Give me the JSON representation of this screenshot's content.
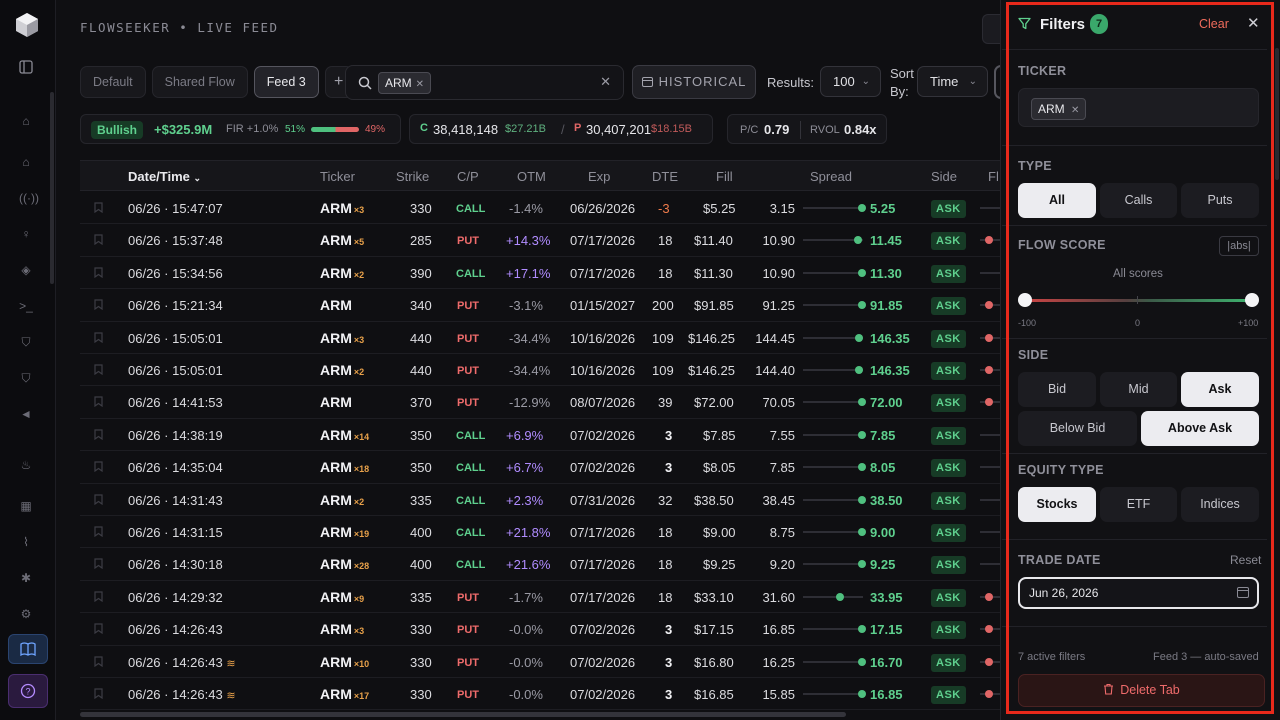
{
  "app": {
    "brand": "FLOWSEEKER • LIVE FEED"
  },
  "rail": {
    "icons": [
      "sidebar-toggle-icon",
      "home-icon",
      "home-alt-icon",
      "broadcast-icon",
      "lightbulb-icon",
      "graduation-cap-icon",
      "terminal-icon",
      "shield-icon",
      "shield-alt-icon",
      "megaphone-icon",
      "flame-icon",
      "grid-icon",
      "chart-icon",
      "bug-icon",
      "settings-icon"
    ],
    "book_icon": "book-icon",
    "help_icon": "help-icon"
  },
  "tabs": [
    {
      "label": "Default",
      "active": false
    },
    {
      "label": "Shared Flow",
      "active": false
    },
    {
      "label": "Feed 3",
      "active": true
    }
  ],
  "search": {
    "chip": "ARM",
    "clear": "✕"
  },
  "toolbar": {
    "historical": "HISTORICAL",
    "results_label": "Results:",
    "results_value": "100",
    "sort_label_1": "Sort",
    "sort_label_2": "By:",
    "sort_value": "Time"
  },
  "stats": {
    "sentiment": "Bullish",
    "premium": "+$325.9M",
    "fir": "FIR +1.0%",
    "bull_pct": "51%",
    "bear_pct": "49%",
    "bull_fraction": 0.51,
    "calls_prefix": "C",
    "calls_count": "38,418,148",
    "calls_premium": "$27.21B",
    "sep": "/",
    "puts_prefix": "P",
    "puts_count": "30,407,201",
    "puts_premium": "$18.15B",
    "pc_label": "P/C",
    "pc_value": "0.79",
    "rvol_label": "RVOL",
    "rvol_value": "0.84x"
  },
  "table": {
    "headers": {
      "datetime": "Date/Time",
      "ticker": "Ticker",
      "strike": "Strike",
      "cp": "C/P",
      "otm": "OTM",
      "exp": "Exp",
      "dte": "DTE",
      "fill": "Fill",
      "spread": "Spread",
      "side": "Side",
      "fl": "Fl"
    },
    "rows": [
      {
        "dt": "06/26 · 15:47:07",
        "ticker": "ARM",
        "mult": "×3",
        "strike": "330",
        "cp": "CALL",
        "otm": "-1.4%",
        "exp": "06/26/2026",
        "dte": "-3",
        "fill": "$5.25",
        "bid": "3.15",
        "ask_px": "5.25",
        "side": "ASK",
        "pos": 0.98
      },
      {
        "dt": "06/26 · 15:37:48",
        "ticker": "ARM",
        "mult": "×5",
        "strike": "285",
        "cp": "PUT",
        "otm": "+14.3%",
        "exp": "07/17/2026",
        "dte": "18",
        "fill": "$11.40",
        "bid": "10.90",
        "ask_px": "11.45",
        "side": "ASK",
        "pos": 0.91
      },
      {
        "dt": "06/26 · 15:34:56",
        "ticker": "ARM",
        "mult": "×2",
        "strike": "390",
        "cp": "CALL",
        "otm": "+17.1%",
        "exp": "07/17/2026",
        "dte": "18",
        "fill": "$11.30",
        "bid": "10.90",
        "ask_px": "11.30",
        "side": "ASK",
        "pos": 0.98
      },
      {
        "dt": "06/26 · 15:21:34",
        "ticker": "ARM",
        "mult": "",
        "strike": "340",
        "cp": "PUT",
        "otm": "-3.1%",
        "exp": "01/15/2027",
        "dte": "200",
        "fill": "$91.85",
        "bid": "91.25",
        "ask_px": "91.85",
        "side": "ASK",
        "pos": 0.98
      },
      {
        "dt": "06/26 · 15:05:01",
        "ticker": "ARM",
        "mult": "×3",
        "strike": "440",
        "cp": "PUT",
        "otm": "-34.4%",
        "exp": "10/16/2026",
        "dte": "109",
        "fill": "$146.25",
        "bid": "144.45",
        "ask_px": "146.35",
        "side": "ASK",
        "pos": 0.93
      },
      {
        "dt": "06/26 · 15:05:01",
        "ticker": "ARM",
        "mult": "×2",
        "strike": "440",
        "cp": "PUT",
        "otm": "-34.4%",
        "exp": "10/16/2026",
        "dte": "109",
        "fill": "$146.25",
        "bid": "144.40",
        "ask_px": "146.35",
        "side": "ASK",
        "pos": 0.93
      },
      {
        "dt": "06/26 · 14:41:53",
        "ticker": "ARM",
        "mult": "",
        "strike": "370",
        "cp": "PUT",
        "otm": "-12.9%",
        "exp": "08/07/2026",
        "dte": "39",
        "fill": "$72.00",
        "bid": "70.05",
        "ask_px": "72.00",
        "side": "ASK",
        "pos": 0.98
      },
      {
        "dt": "06/26 · 14:38:19",
        "ticker": "ARM",
        "mult": "×14",
        "strike": "350",
        "cp": "CALL",
        "otm": "+6.9%",
        "exp": "07/02/2026",
        "dte": "3",
        "fill": "$7.85",
        "bid": "7.55",
        "ask_px": "7.85",
        "side": "ASK",
        "pos": 0.98
      },
      {
        "dt": "06/26 · 14:35:04",
        "ticker": "ARM",
        "mult": "×18",
        "strike": "350",
        "cp": "CALL",
        "otm": "+6.7%",
        "exp": "07/02/2026",
        "dte": "3",
        "fill": "$8.05",
        "bid": "7.85",
        "ask_px": "8.05",
        "side": "ASK",
        "pos": 0.98
      },
      {
        "dt": "06/26 · 14:31:43",
        "ticker": "ARM",
        "mult": "×2",
        "strike": "335",
        "cp": "CALL",
        "otm": "+2.3%",
        "exp": "07/31/2026",
        "dte": "32",
        "fill": "$38.50",
        "bid": "38.45",
        "ask_px": "38.50",
        "side": "ASK",
        "pos": 0.98
      },
      {
        "dt": "06/26 · 14:31:15",
        "ticker": "ARM",
        "mult": "×19",
        "strike": "400",
        "cp": "CALL",
        "otm": "+21.8%",
        "exp": "07/17/2026",
        "dte": "18",
        "fill": "$9.00",
        "bid": "8.75",
        "ask_px": "9.00",
        "side": "ASK",
        "pos": 0.98
      },
      {
        "dt": "06/26 · 14:30:18",
        "ticker": "ARM",
        "mult": "×28",
        "strike": "400",
        "cp": "CALL",
        "otm": "+21.6%",
        "exp": "07/17/2026",
        "dte": "18",
        "fill": "$9.25",
        "bid": "9.20",
        "ask_px": "9.25",
        "side": "ASK",
        "pos": 0.98
      },
      {
        "dt": "06/26 · 14:29:32",
        "ticker": "ARM",
        "mult": "×9",
        "strike": "335",
        "cp": "PUT",
        "otm": "-1.7%",
        "exp": "07/17/2026",
        "dte": "18",
        "fill": "$33.10",
        "bid": "31.60",
        "ask_px": "33.95",
        "side": "ASK",
        "pos": 0.62
      },
      {
        "dt": "06/26 · 14:26:43",
        "ticker": "ARM",
        "mult": "×3",
        "strike": "330",
        "cp": "PUT",
        "otm": "-0.0%",
        "exp": "07/02/2026",
        "dte": "3",
        "fill": "$17.15",
        "bid": "16.85",
        "ask_px": "17.15",
        "side": "ASK",
        "pos": 0.98
      },
      {
        "dt": "06/26 · 14:26:43",
        "ticker": "ARM",
        "mult": "×10",
        "strike": "330",
        "cp": "PUT",
        "otm": "-0.0%",
        "exp": "07/02/2026",
        "dte": "3",
        "fill": "$16.80",
        "bid": "16.25",
        "ask_px": "16.70",
        "side": "ASK",
        "pos": 0.98,
        "sweep": true
      },
      {
        "dt": "06/26 · 14:26:43",
        "ticker": "ARM",
        "mult": "×17",
        "strike": "330",
        "cp": "PUT",
        "otm": "-0.0%",
        "exp": "07/02/2026",
        "dte": "3",
        "fill": "$16.85",
        "bid": "15.85",
        "ask_px": "16.85",
        "side": "ASK",
        "pos": 0.98,
        "sweep": true
      }
    ]
  },
  "filters": {
    "title": "Filters",
    "count": "7",
    "clear": "Clear",
    "ticker_label": "TICKER",
    "ticker_chip": "ARM",
    "type_label": "TYPE",
    "type_options": [
      "All",
      "Calls",
      "Puts"
    ],
    "type_selected": "All",
    "score_label": "FLOW SCORE",
    "abs_label": "|abs|",
    "score_caption": "All scores",
    "score_min": "-100",
    "score_mid": "0",
    "score_max": "+100",
    "side_label": "SIDE",
    "side_options": [
      "Bid",
      "Mid",
      "Ask",
      "Below Bid",
      "Above Ask"
    ],
    "side_selected": [
      "Ask",
      "Above Ask"
    ],
    "equity_label": "EQUITY TYPE",
    "equity_options": [
      "Stocks",
      "ETF",
      "Indices"
    ],
    "equity_selected": "Stocks",
    "trade_date_label": "TRADE DATE",
    "reset": "Reset",
    "trade_date": "Jun 26, 2026",
    "footer_left": "7 active filters",
    "footer_right": "Feed 3 — auto-saved",
    "delete": "Delete Tab"
  },
  "colors": {
    "accent_green": "#5fd08e",
    "put_red": "#ee6b6b",
    "highlight": "#e8291b"
  }
}
